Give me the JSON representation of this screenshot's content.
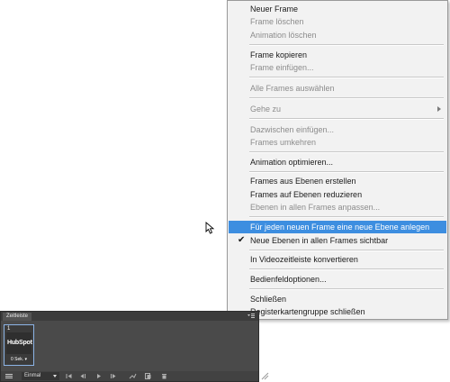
{
  "menu": {
    "items": [
      {
        "label": "Neuer Frame",
        "disabled": false
      },
      {
        "label": "Frame löschen",
        "disabled": true
      },
      {
        "label": "Animation löschen",
        "disabled": true
      },
      {
        "label": "Frame kopieren",
        "disabled": false
      },
      {
        "label": "Frame einfügen...",
        "disabled": true
      },
      {
        "label": "Alle Frames auswählen",
        "disabled": true
      },
      {
        "label": "Gehe zu",
        "disabled": true,
        "submenu": true
      },
      {
        "label": "Dazwischen einfügen...",
        "disabled": true
      },
      {
        "label": "Frames umkehren",
        "disabled": true
      },
      {
        "label": "Animation optimieren...",
        "disabled": false
      },
      {
        "label": "Frames aus Ebenen erstellen",
        "disabled": false
      },
      {
        "label": "Frames auf Ebenen reduzieren",
        "disabled": false
      },
      {
        "label": "Ebenen in allen Frames anpassen...",
        "disabled": true
      },
      {
        "label": "Für jeden neuen Frame eine neue Ebene anlegen",
        "disabled": false,
        "highlighted": true
      },
      {
        "label": "Neue Ebenen in allen Frames sichtbar",
        "disabled": false,
        "checked": true
      },
      {
        "label": "In Videozeitleiste konvertieren",
        "disabled": false
      },
      {
        "label": "Bedienfeldoptionen...",
        "disabled": false
      },
      {
        "label": "Schließen",
        "disabled": false
      },
      {
        "label": "Registerkartengruppe schließen",
        "disabled": false
      }
    ],
    "check_mark": "✔"
  },
  "panel": {
    "tab_label": "Zeitleiste",
    "frame": {
      "number": "1",
      "logo_text": "HubSpot",
      "delay": "0 Sek."
    },
    "loop_select": "Einmal"
  },
  "colors": {
    "highlight": "#3d8ee0",
    "panel_bg": "#535353",
    "menu_bg": "#f2f2f2"
  }
}
